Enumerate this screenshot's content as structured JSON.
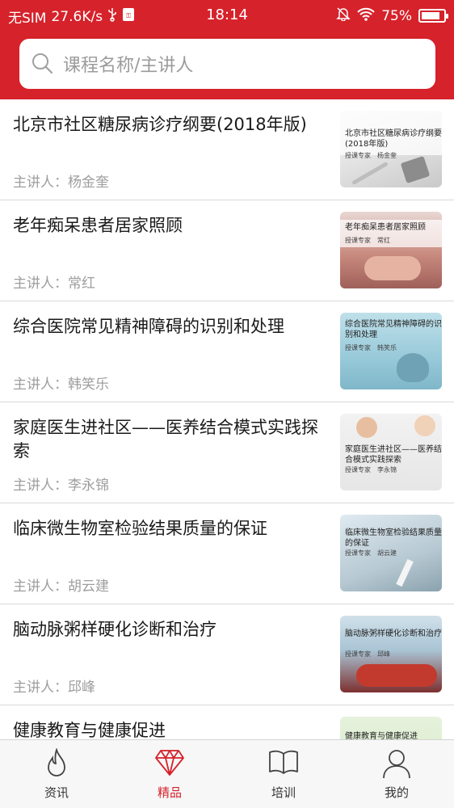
{
  "status_bar": {
    "carrier": "无SIM",
    "speed": "27.6K/s",
    "time": "18:14",
    "battery": "75%",
    "icons": [
      "usb-icon",
      "sim-icon",
      "mute-icon",
      "wifi-icon",
      "battery-icon"
    ]
  },
  "search": {
    "placeholder": "课程名称/主讲人"
  },
  "courses": [
    {
      "title": "北京市社区糖尿病诊疗纲要(2018年版)",
      "speaker": "主讲人：杨金奎",
      "thumb_caption": "北京市社区糖尿病诊疗纲要(2018年版)",
      "thumb_sub": "授课专家　杨金奎"
    },
    {
      "title": "老年痴呆患者居家照顾",
      "speaker": "主讲人：常红",
      "thumb_caption": "老年痴呆患者居家照顾",
      "thumb_sub": "授课专家　常红"
    },
    {
      "title": "综合医院常见精神障碍的识别和处理",
      "speaker": "主讲人：韩笑乐",
      "thumb_caption": "综合医院常见精神障碍的识别和处理",
      "thumb_sub": "授课专家　韩笑乐"
    },
    {
      "title": "家庭医生进社区——医养结合模式实践探索",
      "speaker": "主讲人：李永锦",
      "thumb_caption": "家庭医生进社区——医养结合模式实践探索",
      "thumb_sub": "授课专家　李永锦"
    },
    {
      "title": "临床微生物室检验结果质量的保证",
      "speaker": "主讲人：胡云建",
      "thumb_caption": "临床微生物室检验结果质量的保证",
      "thumb_sub": "授课专家　胡云建"
    },
    {
      "title": "脑动脉粥样硬化诊断和治疗",
      "speaker": "主讲人：邱峰",
      "thumb_caption": "脑动脉粥样硬化诊断和治疗",
      "thumb_sub": "授课专家　邱峰"
    },
    {
      "title": "健康教育与健康促进",
      "speaker": "",
      "thumb_caption": "健康教育与健康促进",
      "thumb_sub": ""
    }
  ],
  "tabs": [
    {
      "label": "资讯",
      "icon": "flame-icon",
      "active": false
    },
    {
      "label": "精品",
      "icon": "diamond-icon",
      "active": true
    },
    {
      "label": "培训",
      "icon": "book-icon",
      "active": false
    },
    {
      "label": "我的",
      "icon": "person-icon",
      "active": false
    }
  ],
  "colors": {
    "brand": "#d6222b",
    "active_tab": "#d6222b",
    "secondary_text": "#9e9e9e"
  }
}
